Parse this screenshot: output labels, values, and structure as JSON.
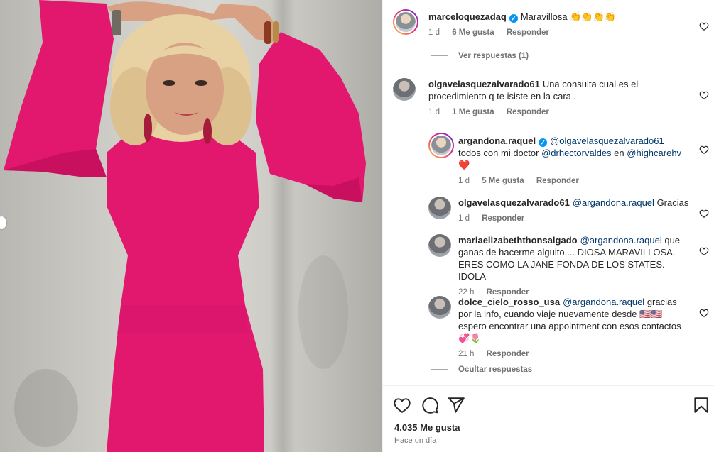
{
  "comments": [
    {
      "user": "marceloquezadaq",
      "verified": true,
      "text": "Maravillosa 👏👏👏👏",
      "time": "1 d",
      "likes": "6 Me gusta",
      "reply_label": "Responder",
      "toggle": "Ver respuestas (1)"
    },
    {
      "user": "olgavelasquezalvarado61",
      "text": "Una consulta cual es el procedimiento q te isiste en la cara .",
      "time": "1 d",
      "likes": "1 Me gusta",
      "reply_label": "Responder",
      "replies": [
        {
          "user": "argandona.raquel",
          "verified": true,
          "mention": "@olgavelasquezalvarado61",
          "text_a": "todos con mi doctor",
          "mention2": "@drhectorvaldes",
          "text_b": "en",
          "mention3": "@highcarehv",
          "text_c": "❤️",
          "time": "1 d",
          "likes": "5 Me gusta",
          "reply_label": "Responder"
        },
        {
          "user": "olgavelasquezalvarado61",
          "mention": "@argandona.raquel",
          "text": "Gracias",
          "time": "1 d",
          "reply_label": "Responder"
        },
        {
          "user": "mariaelizabeththonsalgado",
          "mention": "@argandona.raquel",
          "text": "que ganas de hacerme alguito.... DIOSA MARAVILLOSA. ERES COMO LA JANE FONDA DE LOS STATES. IDOLA",
          "time": "22 h",
          "reply_label": "Responder"
        },
        {
          "user": "dolce_cielo_rosso_usa",
          "mention": "@argandona.raquel",
          "text": "gracias por la info, cuando viaje nuevamente desde 🇺🇸🇺🇸 espero encontrar una appointment con esos contactos 💞🌷",
          "time": "21 h",
          "reply_label": "Responder"
        }
      ],
      "toggle": "Ocultar respuestas"
    }
  ],
  "post": {
    "likes": "4.035 Me gusta",
    "time": "Hace un día"
  },
  "icons": [
    "heart-icon",
    "comment-icon",
    "share-icon",
    "bookmark-icon"
  ],
  "colors": {
    "accent_dress": "#e2186f",
    "verified": "#0095f6",
    "mention": "#00376b"
  }
}
